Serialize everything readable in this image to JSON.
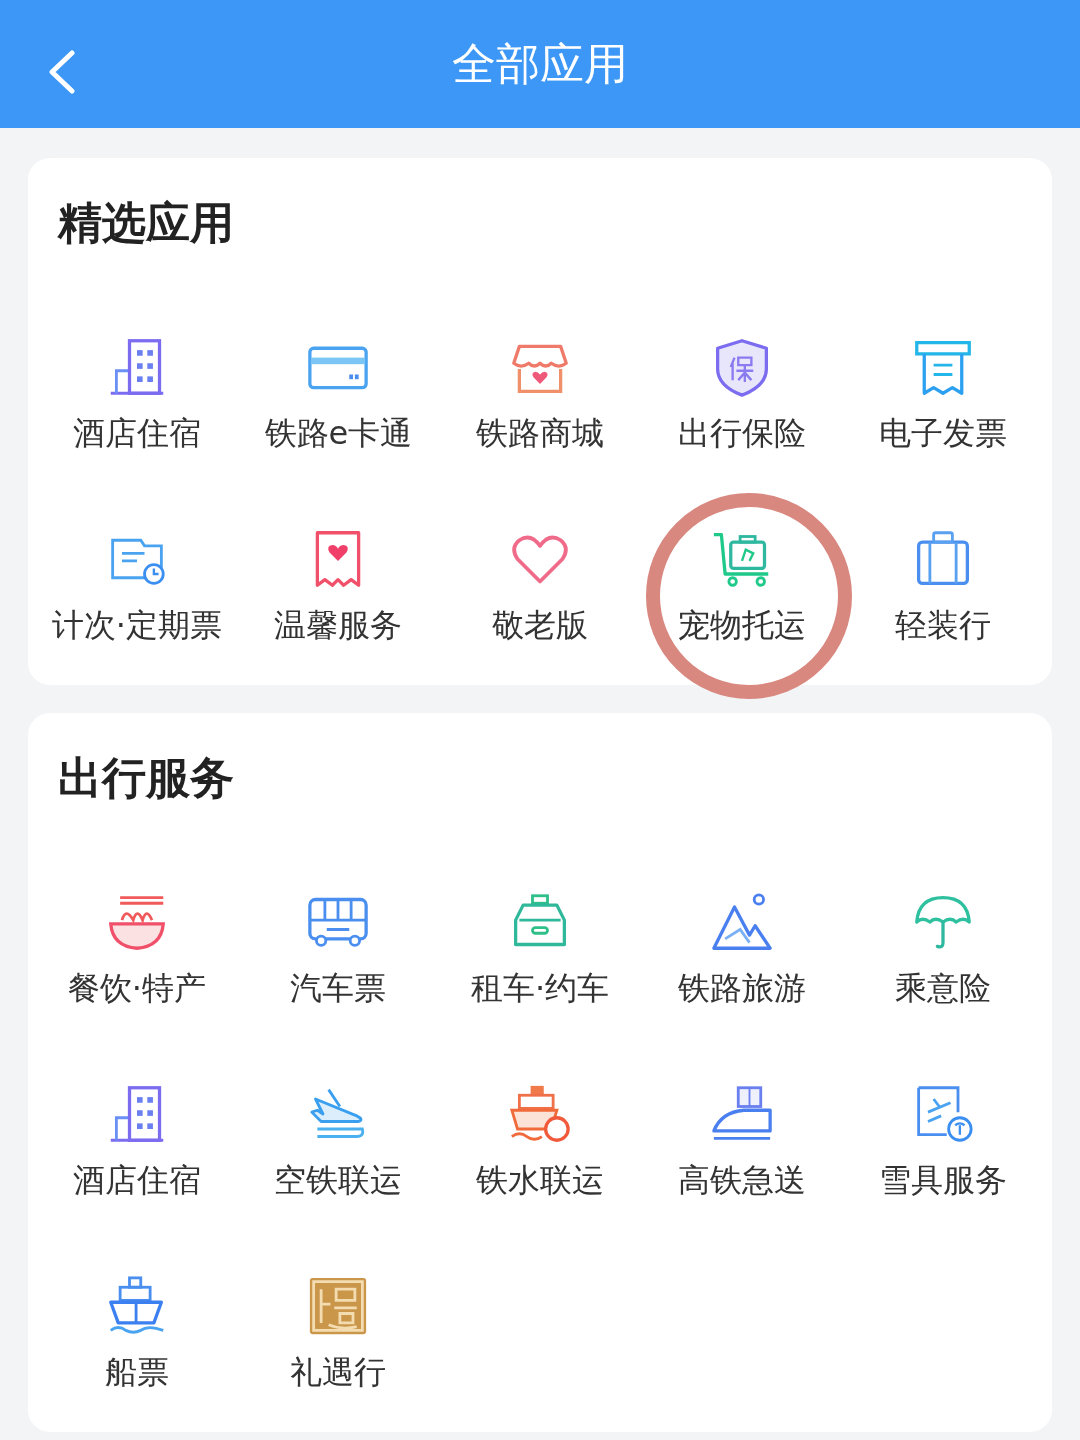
{
  "header": {
    "title": "全部应用"
  },
  "sections": [
    {
      "title": "精选应用",
      "apps": [
        {
          "label": "酒店住宿"
        },
        {
          "label": "铁路e卡通"
        },
        {
          "label": "铁路商城"
        },
        {
          "label": "出行保险"
        },
        {
          "label": "电子发票"
        },
        {
          "label": "计次·定期票"
        },
        {
          "label": "温馨服务"
        },
        {
          "label": "敬老版"
        },
        {
          "label": "宠物托运",
          "highlighted": true
        },
        {
          "label": "轻装行"
        }
      ]
    },
    {
      "title": "出行服务",
      "apps": [
        {
          "label": "餐饮·特产"
        },
        {
          "label": "汽车票"
        },
        {
          "label": "租车·约车"
        },
        {
          "label": "铁路旅游"
        },
        {
          "label": "乘意险"
        },
        {
          "label": "酒店住宿"
        },
        {
          "label": "空铁联运"
        },
        {
          "label": "铁水联运"
        },
        {
          "label": "高铁急送"
        },
        {
          "label": "雪具服务"
        },
        {
          "label": "船票"
        },
        {
          "label": "礼遇行"
        }
      ]
    }
  ]
}
